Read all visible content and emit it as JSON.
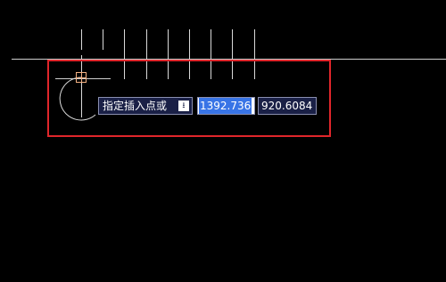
{
  "command_prompt": {
    "label": "指定插入点或",
    "dropdown_icon": "down-arrow-icon"
  },
  "coordinates": {
    "x_value": "1392.736",
    "y_value": "920.6084"
  },
  "colors": {
    "background": "#000000",
    "highlight_border": "#e0262b",
    "prompt_bg": "#1a2046",
    "selection": "#3874e6",
    "snap_marker": "#f4b183"
  }
}
